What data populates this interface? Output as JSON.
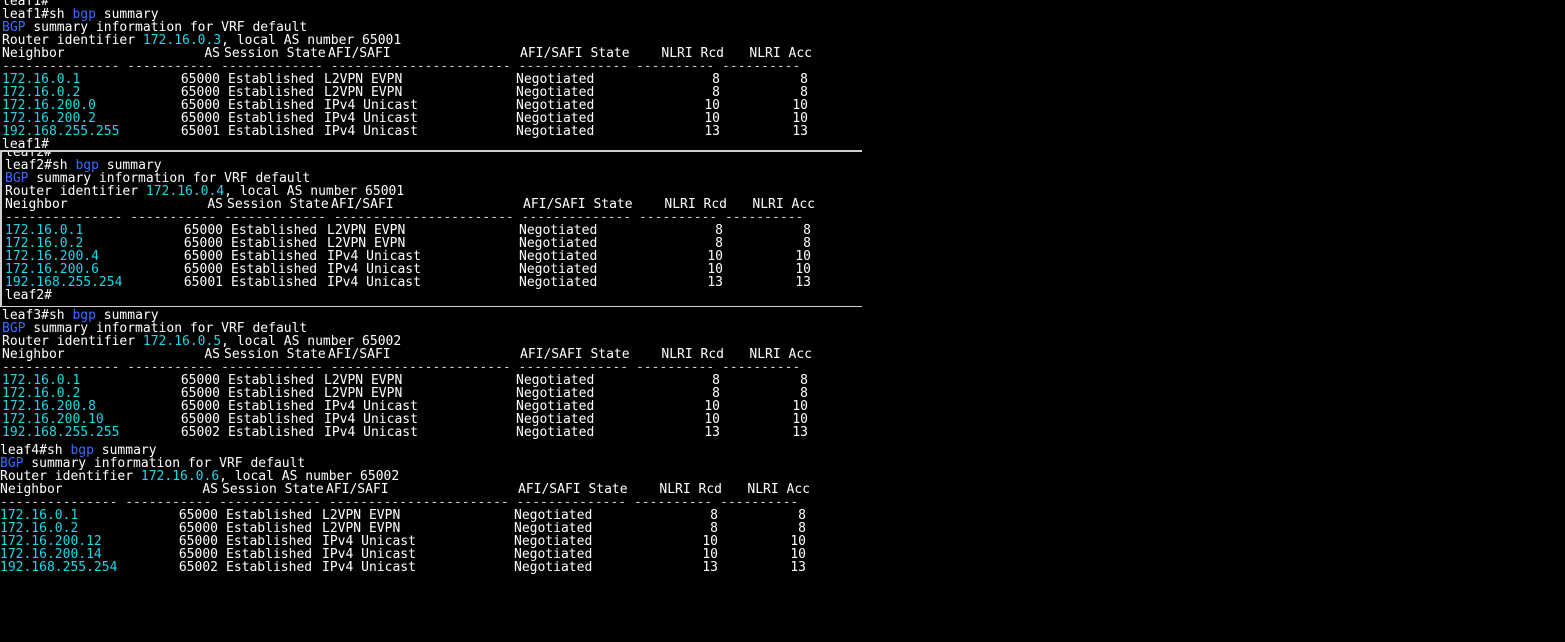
{
  "leaf1": {
    "prev_prompt": "leaf1#",
    "prompt": "leaf1#",
    "command": "sh bgp summary",
    "cmd_sh": "sh",
    "cmd_bgp": "bgp",
    "cmd_summary": "summary",
    "bgp": "BGP",
    "summary_text": " summary information for VRF default",
    "router_prefix": "Router identifier ",
    "router_id": "172.16.0.3",
    "local_as_text": ", local AS number 65001",
    "end_prompt": "leaf1#",
    "rows": [
      {
        "neighbor": "172.16.0.1",
        "as": "65000",
        "state": "Established",
        "afi": "L2VPN EVPN",
        "afi_state": "Negotiated",
        "rcd": "8",
        "acc": "8"
      },
      {
        "neighbor": "172.16.0.2",
        "as": "65000",
        "state": "Established",
        "afi": "L2VPN EVPN",
        "afi_state": "Negotiated",
        "rcd": "8",
        "acc": "8"
      },
      {
        "neighbor": "172.16.200.0",
        "as": "65000",
        "state": "Established",
        "afi": "IPv4 Unicast",
        "afi_state": "Negotiated",
        "rcd": "10",
        "acc": "10"
      },
      {
        "neighbor": "172.16.200.2",
        "as": "65000",
        "state": "Established",
        "afi": "IPv4 Unicast",
        "afi_state": "Negotiated",
        "rcd": "10",
        "acc": "10"
      },
      {
        "neighbor": "192.168.255.255",
        "as": "65001",
        "state": "Established",
        "afi": "IPv4 Unicast",
        "afi_state": "Negotiated",
        "rcd": "13",
        "acc": "13"
      }
    ]
  },
  "leaf2": {
    "prev_prompt": "leaf2#",
    "prompt": "leaf2#",
    "cmd_bgp": "bgp",
    "bgp": "BGP",
    "summary_text": " summary information for VRF default",
    "router_prefix": "Router identifier ",
    "router_id": "172.16.0.4",
    "local_as_text": ", local AS number 65001",
    "end_prompt": "leaf2#",
    "rows": [
      {
        "neighbor": "172.16.0.1",
        "as": "65000",
        "state": "Established",
        "afi": "L2VPN EVPN",
        "afi_state": "Negotiated",
        "rcd": "8",
        "acc": "8"
      },
      {
        "neighbor": "172.16.0.2",
        "as": "65000",
        "state": "Established",
        "afi": "L2VPN EVPN",
        "afi_state": "Negotiated",
        "rcd": "8",
        "acc": "8"
      },
      {
        "neighbor": "172.16.200.4",
        "as": "65000",
        "state": "Established",
        "afi": "IPv4 Unicast",
        "afi_state": "Negotiated",
        "rcd": "10",
        "acc": "10"
      },
      {
        "neighbor": "172.16.200.6",
        "as": "65000",
        "state": "Established",
        "afi": "IPv4 Unicast",
        "afi_state": "Negotiated",
        "rcd": "10",
        "acc": "10"
      },
      {
        "neighbor": "192.168.255.254",
        "as": "65001",
        "state": "Established",
        "afi": "IPv4 Unicast",
        "afi_state": "Negotiated",
        "rcd": "13",
        "acc": "13"
      }
    ]
  },
  "leaf3": {
    "prompt": "leaf3#",
    "cmd_bgp": "bgp",
    "bgp": "BGP",
    "summary_text": " summary information for VRF default",
    "router_prefix": "Router identifier ",
    "router_id": "172.16.0.5",
    "local_as_text": ", local AS number 65002",
    "rows": [
      {
        "neighbor": "172.16.0.1",
        "as": "65000",
        "state": "Established",
        "afi": "L2VPN EVPN",
        "afi_state": "Negotiated",
        "rcd": "8",
        "acc": "8"
      },
      {
        "neighbor": "172.16.0.2",
        "as": "65000",
        "state": "Established",
        "afi": "L2VPN EVPN",
        "afi_state": "Negotiated",
        "rcd": "8",
        "acc": "8"
      },
      {
        "neighbor": "172.16.200.8",
        "as": "65000",
        "state": "Established",
        "afi": "IPv4 Unicast",
        "afi_state": "Negotiated",
        "rcd": "10",
        "acc": "10"
      },
      {
        "neighbor": "172.16.200.10",
        "as": "65000",
        "state": "Established",
        "afi": "IPv4 Unicast",
        "afi_state": "Negotiated",
        "rcd": "10",
        "acc": "10"
      },
      {
        "neighbor": "192.168.255.255",
        "as": "65002",
        "state": "Established",
        "afi": "IPv4 Unicast",
        "afi_state": "Negotiated",
        "rcd": "13",
        "acc": "13"
      }
    ]
  },
  "leaf4": {
    "prompt": "leaf4#",
    "cmd_bgp": "bgp",
    "bgp": "BGP",
    "summary_text": " summary information for VRF default",
    "router_prefix": "Router identifier ",
    "router_id": "172.16.0.6",
    "local_as_text": ", local AS number 65002",
    "rows": [
      {
        "neighbor": "172.16.0.1",
        "as": "65000",
        "state": "Established",
        "afi": "L2VPN EVPN",
        "afi_state": "Negotiated",
        "rcd": "8",
        "acc": "8"
      },
      {
        "neighbor": "172.16.0.2",
        "as": "65000",
        "state": "Established",
        "afi": "L2VPN EVPN",
        "afi_state": "Negotiated",
        "rcd": "8",
        "acc": "8"
      },
      {
        "neighbor": "172.16.200.12",
        "as": "65000",
        "state": "Established",
        "afi": "IPv4 Unicast",
        "afi_state": "Negotiated",
        "rcd": "10",
        "acc": "10"
      },
      {
        "neighbor": "172.16.200.14",
        "as": "65000",
        "state": "Established",
        "afi": "IPv4 Unicast",
        "afi_state": "Negotiated",
        "rcd": "10",
        "acc": "10"
      },
      {
        "neighbor": "192.168.255.254",
        "as": "65002",
        "state": "Established",
        "afi": "IPv4 Unicast",
        "afi_state": "Negotiated",
        "rcd": "13",
        "acc": "13"
      }
    ]
  },
  "headers": {
    "neighbor": "Neighbor",
    "as": "AS",
    "session_state": "Session State",
    "afi_safi": "AFI/SAFI",
    "afi_safi_state": "AFI/SAFI State",
    "nlri_rcd": "NLRI Rcd",
    "nlri_acc": "NLRI Acc",
    "dashes": "--------------- ----------- ------------- ----------------------- -------------- ---------- ----------"
  },
  "colors": {
    "background": "#000000",
    "text": "#ffffff",
    "ip": "#1ad8e8",
    "keyword": "#3a6bff"
  }
}
